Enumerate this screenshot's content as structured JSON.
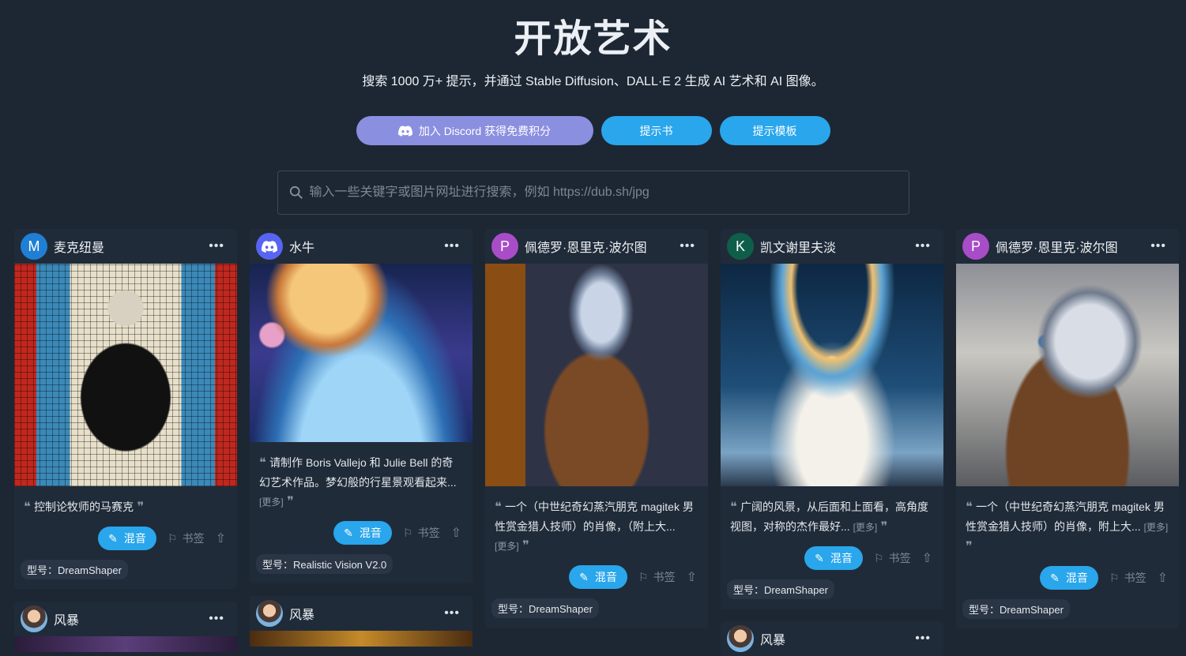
{
  "hero": {
    "title": "开放艺术",
    "subtitle": "搜索 1000 万+ 提示，并通过 Stable Diffusion、DALL·E 2 生成 AI 艺术和 AI 图像。"
  },
  "buttons": {
    "discord": "加入 Discord 获得免费积分",
    "promptbook": "提示书",
    "templates": "提示模板"
  },
  "search": {
    "placeholder": "输入一些关键字或图片网址进行搜索，例如 https://dub.sh/jpg"
  },
  "colors": {
    "background": "#1d2734",
    "card": "#202b39",
    "accent_blue": "#29a6ec",
    "discord_purple": "#8b8fe0"
  },
  "cards": [
    {
      "user": "麦克纽曼",
      "avatar_letter": "M",
      "avatar_color": "#1f7fd4",
      "prompt": "控制论牧师的马赛克",
      "more": "",
      "remix": "混音",
      "bookmark": "书签",
      "model": "型号：DreamShaper"
    },
    {
      "user": "水牛",
      "avatar_letter": "",
      "avatar_icon": "discord-icon",
      "avatar_color": "#5865f2",
      "prompt": "请制作 Boris Vallejo 和 Julie Bell 的奇幻艺术作品。梦幻般的行星景观看起来...",
      "more": "[更多]",
      "remix": "混音",
      "bookmark": "书签",
      "model": "型号：Realistic Vision V2.0"
    },
    {
      "user": "佩德罗·恩里克·波尔图",
      "avatar_letter": "P",
      "avatar_color": "#a84dc7",
      "prompt": "一个（中世纪奇幻蒸汽朋克 magitek 男性赏金猎人技师）的肖像，（附上大...",
      "more": "[更多]",
      "remix": "混音",
      "bookmark": "书签",
      "model": "型号：DreamShaper"
    },
    {
      "user": "凯文谢里夫淡",
      "avatar_letter": "K",
      "avatar_color": "#0f5e4a",
      "prompt": "广阔的风景，从后面和上面看，高角度视图，对称的杰作最好...",
      "more": "[更多]",
      "remix": "混音",
      "bookmark": "书签",
      "model": "型号：DreamShaper"
    },
    {
      "user": "佩德罗·恩里克·波尔图",
      "avatar_letter": "P",
      "avatar_color": "#a84dc7",
      "prompt": "一个（中世纪奇幻蒸汽朋克 magitek 男性赏金猎人技师）的肖像，附上大...",
      "more": "[更多]",
      "remix": "混音",
      "bookmark": "书签",
      "model": "型号：DreamShaper"
    }
  ],
  "next_row": {
    "user": "风暴"
  }
}
